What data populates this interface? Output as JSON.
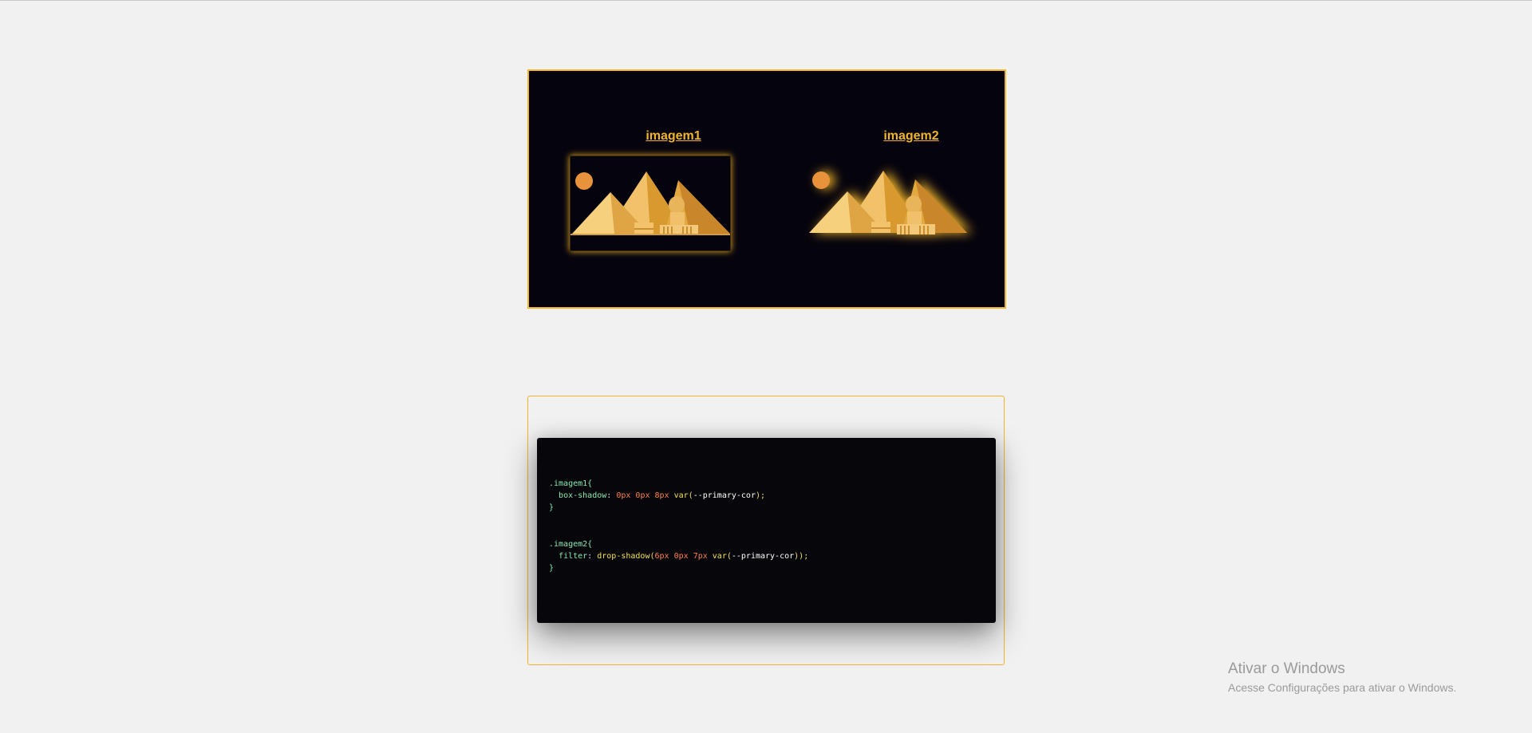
{
  "demo": {
    "image1_title": "imagem1",
    "image2_title": "imagem2",
    "accent_color": "#f3b62a",
    "panel_background": "#05030d"
  },
  "code": {
    "rule1_selector": ".imagem1{",
    "rule1_property": "box-shadow",
    "rule1_colon": ":",
    "rule1_values": [
      "0px",
      "0px",
      "8px"
    ],
    "rule1_fn": "var",
    "rule1_arg": "--primary-cor",
    "rule1_end": ");",
    "rule1_close": "}",
    "rule2_selector": ".imagem2{",
    "rule2_property": "filter",
    "rule2_colon": ":",
    "rule2_fn_outer": "drop-shadow",
    "rule2_values": [
      "6px",
      "0px",
      "7px"
    ],
    "rule2_fn": "var",
    "rule2_arg": "--primary-cor",
    "rule2_end": "));",
    "rule2_close": "}"
  },
  "watermark": {
    "title": "Ativar o Windows",
    "subtitle": "Acesse Configurações para ativar o Windows."
  }
}
